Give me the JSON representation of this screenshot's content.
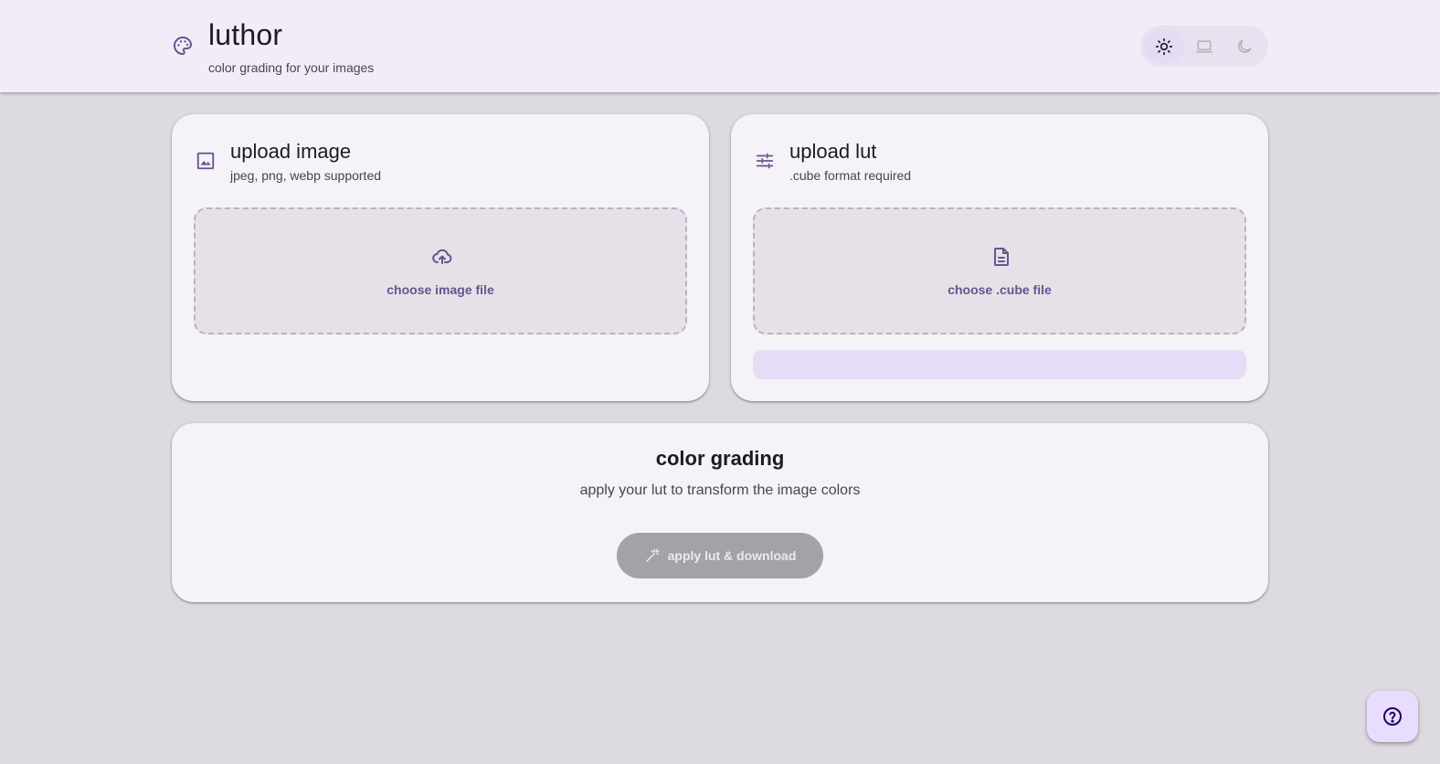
{
  "header": {
    "brand_icon": "palette-icon",
    "title": "luthor",
    "subtitle": "color grading for your images",
    "theme_modes": [
      {
        "name": "light",
        "icon": "sun-icon",
        "active": true
      },
      {
        "name": "system",
        "icon": "laptop-icon",
        "active": false
      },
      {
        "name": "dark",
        "icon": "moon-icon",
        "active": false
      }
    ]
  },
  "upload_image": {
    "icon": "image-icon",
    "title": "upload image",
    "subtitle": "jpeg, png, webp supported",
    "dropzone_icon": "cloud-upload-icon",
    "dropzone_label": "choose image file"
  },
  "upload_lut": {
    "icon": "sliders-icon",
    "title": "upload lut",
    "subtitle": ".cube format required",
    "dropzone_icon": "file-icon",
    "dropzone_label": "choose .cube file"
  },
  "color_grading": {
    "title": "color grading",
    "subtitle": "apply your lut to transform the image colors",
    "button_icon": "magic-wand-icon",
    "button_label": "apply lut & download",
    "button_disabled": true
  },
  "help": {
    "icon": "help-circle-icon"
  },
  "colors": {
    "accent": "#65558f",
    "background": "#dedae2",
    "header_bg": "#f2ecf8",
    "card_bg": "#f5f2f8",
    "disabled_button": "#a4a1a7"
  }
}
